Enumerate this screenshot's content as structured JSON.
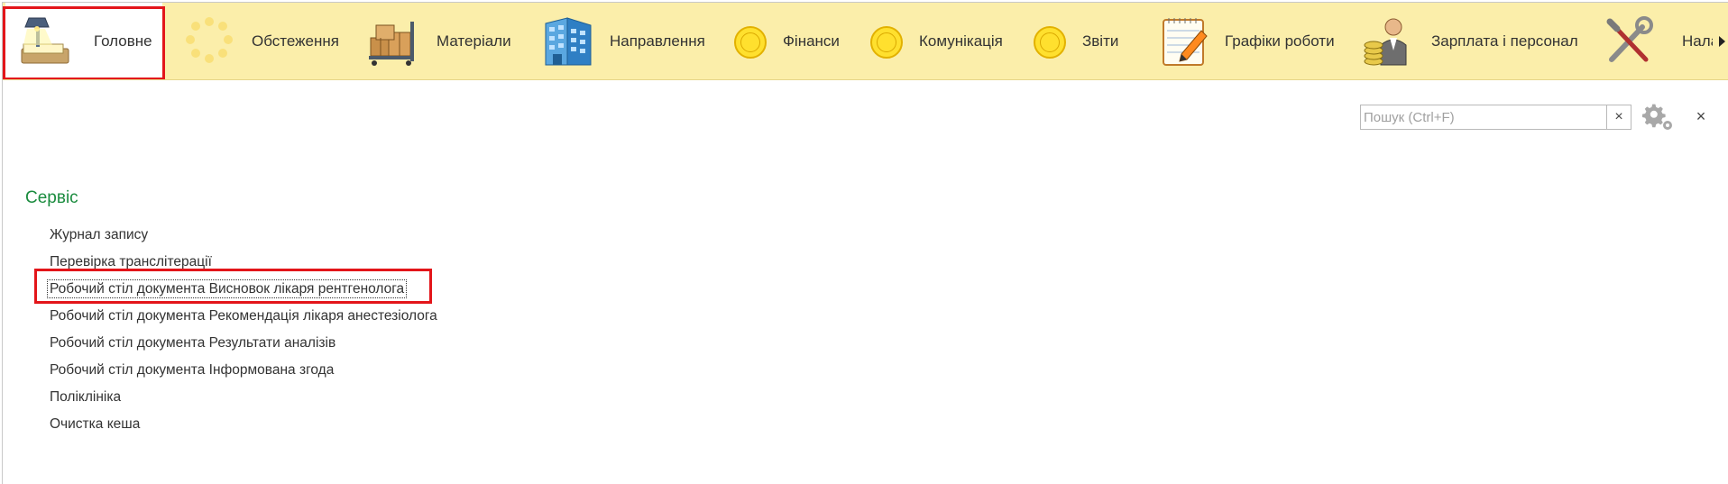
{
  "sections": [
    {
      "label": "Головне",
      "icon": "desk-lamp-icon",
      "active": true
    },
    {
      "label": "Обстеження",
      "icon": "loading-spinner-icon",
      "active": false
    },
    {
      "label": "Матеріали",
      "icon": "boxes-cart-icon",
      "active": false
    },
    {
      "label": "Направлення",
      "icon": "building-icon",
      "active": false
    },
    {
      "label": "Фінанси",
      "icon": "coin-icon",
      "active": false
    },
    {
      "label": "Комунікація",
      "icon": "coin-icon",
      "active": false
    },
    {
      "label": "Звіти",
      "icon": "coin-icon",
      "active": false
    },
    {
      "label": "Графіки роботи",
      "icon": "notepad-pencil-icon",
      "active": false
    },
    {
      "label": "Зарплата і персонал",
      "icon": "person-coins-icon",
      "active": false
    },
    {
      "label": "Налаштування",
      "icon": "tools-icon",
      "active": false
    }
  ],
  "toolbar": {
    "search_placeholder": "Пошук (Ctrl+F)",
    "search_value": "",
    "clear_label": "×",
    "close_label": "×"
  },
  "content": {
    "group_title": "Сервіс",
    "commands": [
      "Журнал запису",
      "Перевірка транслітерації",
      "Робочий стіл документа Висновок лікаря рентгенолога",
      "Робочий стіл документа Рекомендація лікаря анестезіолога",
      "Робочий стіл документа Результати аналізів",
      "Робочий стіл документа Інформована згода",
      "Поліклініка",
      "Очистка кеша"
    ],
    "focused_index": 2
  },
  "colors": {
    "panel_background": "#fbeeaa",
    "group_title": "#1b8c3f",
    "highlight": "#e3151a"
  }
}
